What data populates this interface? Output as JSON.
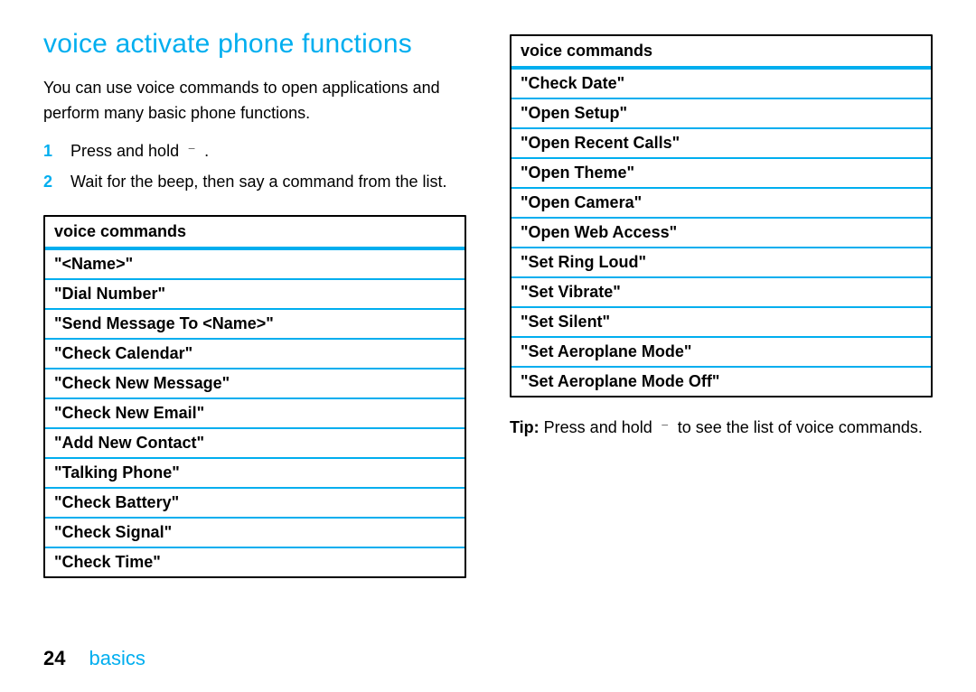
{
  "heading": "voice activate phone functions",
  "intro": "You can use voice commands to open applications and perform many basic phone functions.",
  "steps": [
    {
      "num": "1",
      "text_before": "Press and hold ",
      "glyph": "¯",
      "text_after": " ."
    },
    {
      "num": "2",
      "text_before": "Wait for the beep, then say a command from the list.",
      "glyph": "",
      "text_after": ""
    }
  ],
  "table1_header": "voice commands",
  "table1_rows": [
    "\"<Name>\"",
    "\"Dial Number\"",
    "\"Send Message To <Name>\"",
    "\"Check Calendar\"",
    "\"Check New Message\"",
    "\"Check New Email\"",
    "\"Add New Contact\"",
    "\"Talking Phone\"",
    "\"Check Battery\"",
    "\"Check Signal\"",
    "\"Check Time\""
  ],
  "table2_header": "voice commands",
  "table2_rows": [
    "\"Check Date\"",
    "\"Open Setup\"",
    "\"Open Recent Calls\"",
    "\"Open Theme\"",
    "\"Open Camera\"",
    "\"Open Web Access\"",
    "\"Set Ring Loud\"",
    "\"Set Vibrate\"",
    "\"Set Silent\"",
    "\"Set Aeroplane Mode\"",
    "\"Set Aeroplane Mode Off\""
  ],
  "tip_label": "Tip:",
  "tip_before": " Press and hold ",
  "tip_glyph": "¯",
  "tip_after": "  to see the list of voice commands.",
  "page_number": "24",
  "section": "basics"
}
